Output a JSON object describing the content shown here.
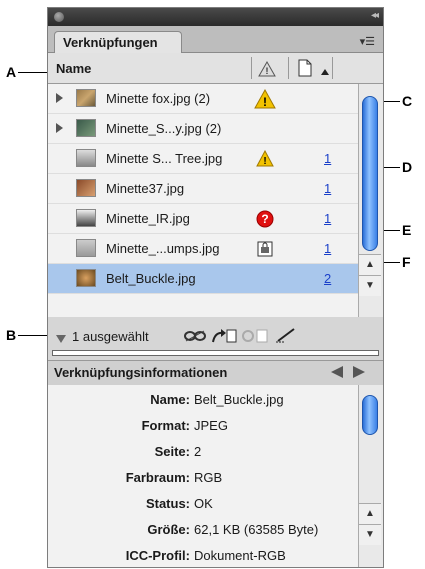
{
  "callouts": {
    "a": "A",
    "b": "B",
    "c": "C",
    "d": "D",
    "e": "E",
    "f": "F"
  },
  "panel": {
    "tab_label": "Verknüpfungen",
    "menu_icon": "panel-menu-icon",
    "column_name": "Name",
    "links": [
      {
        "name": "Minette fox.jpg (2)",
        "page": "",
        "status": "warning-large",
        "expandable": true
      },
      {
        "name": "Minette_S...y.jpg (2)",
        "page": "",
        "status": "",
        "expandable": true
      },
      {
        "name": "Minette S... Tree.jpg",
        "page": "1",
        "status": "warning",
        "expandable": false
      },
      {
        "name": "Minette37.jpg",
        "page": "1",
        "status": "",
        "expandable": false
      },
      {
        "name": "Minette_IR.jpg",
        "page": "1",
        "status": "missing",
        "expandable": false
      },
      {
        "name": "Minette_...umps.jpg",
        "page": "1",
        "status": "embedded",
        "expandable": false
      },
      {
        "name": "Belt_Buckle.jpg",
        "page": "2",
        "status": "",
        "expandable": false,
        "selected": true
      }
    ],
    "selection_status": "1 ausgewählt",
    "info_header": "Verknüpfungsinformationen",
    "info": [
      {
        "key": "Name:",
        "value": "Belt_Buckle.jpg"
      },
      {
        "key": "Format:",
        "value": "JPEG"
      },
      {
        "key": "Seite:",
        "value": "2"
      },
      {
        "key": "Farbraum:",
        "value": "RGB"
      },
      {
        "key": "Status:",
        "value": "OK"
      },
      {
        "key": "Größe:",
        "value": "62,1 KB (63585 Byte)"
      },
      {
        "key": "ICC-Profil:",
        "value": "Dokument-RGB"
      }
    ]
  },
  "colors": {
    "selection": "#a9c7ec",
    "warning": "#f2c200",
    "missing": "#e01010",
    "page_link": "#1a3fc9"
  }
}
